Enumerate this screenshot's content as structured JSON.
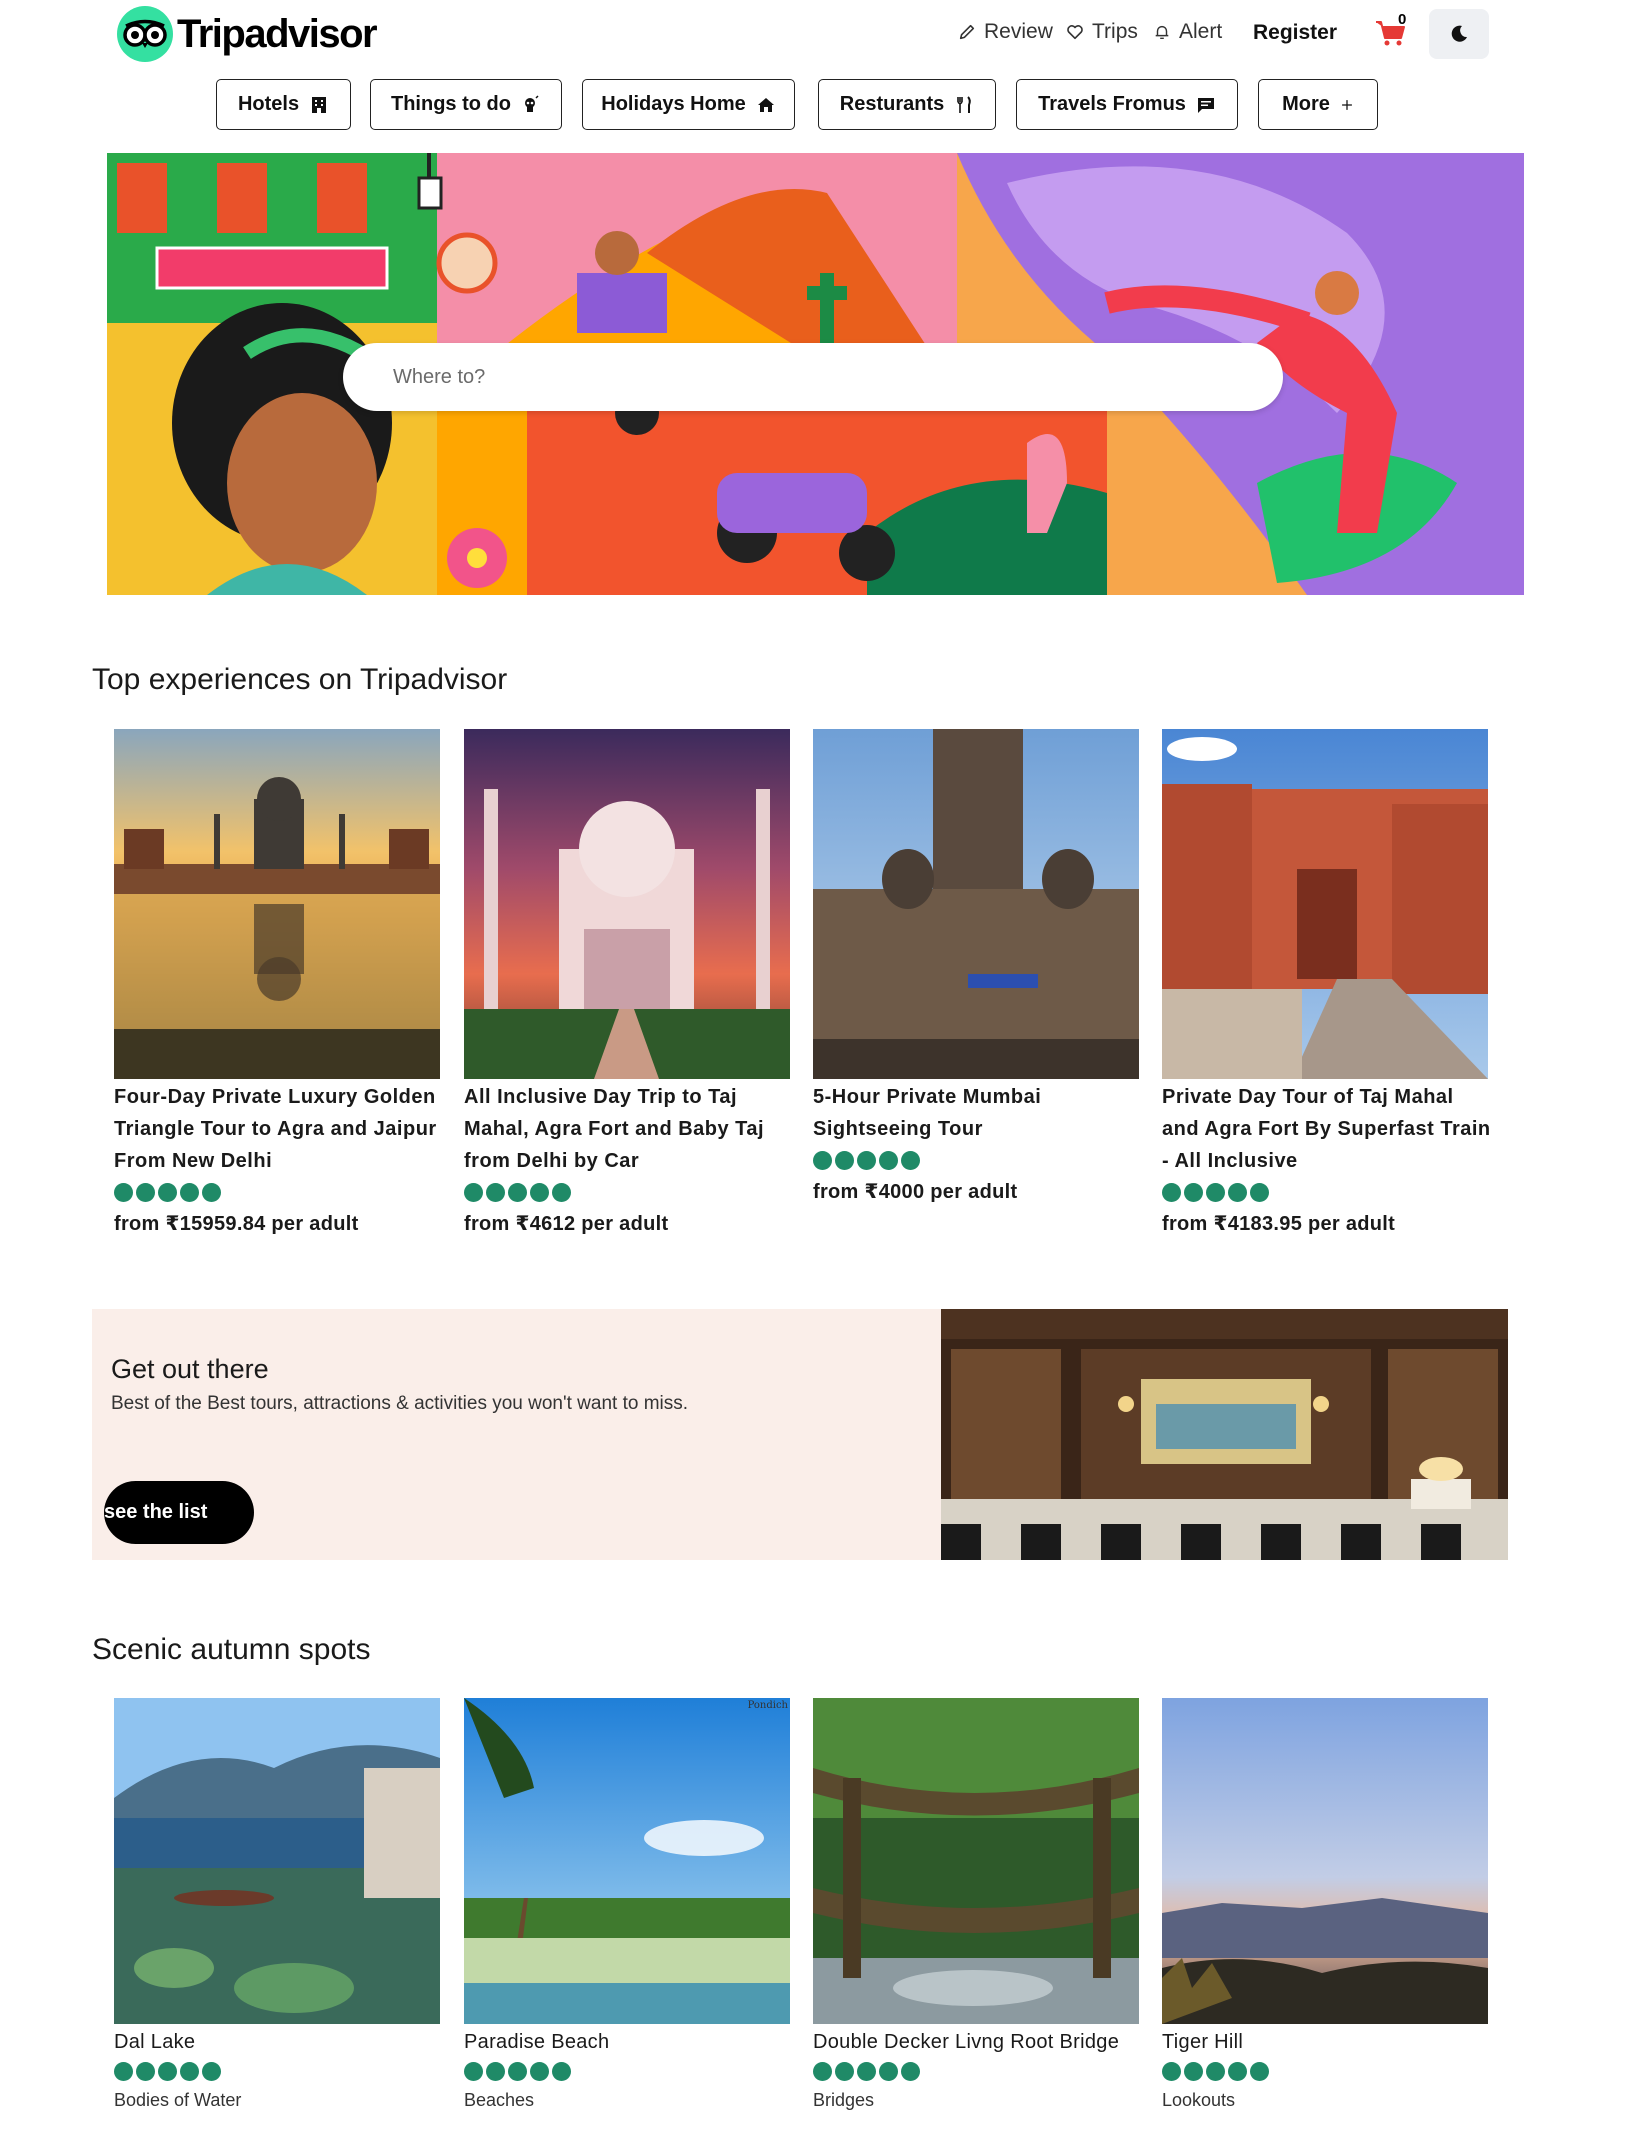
{
  "brand": {
    "name": "Tripadvisor"
  },
  "topnav": {
    "review": "Review",
    "trips": "Trips",
    "alert": "Alert",
    "register": "Register",
    "cart_count": "0"
  },
  "categories": [
    "Hotels",
    "Things to do",
    "Holidays Home",
    "Resturants",
    "Travels Fromus",
    "More"
  ],
  "search": {
    "placeholder": "Where to?"
  },
  "top_experiences": {
    "title": "Top experiences on Tripadvisor",
    "items": [
      {
        "title": "Four-Day Private Luxury Golden Triangle Tour to Agra and Jaipur From New Delhi",
        "rating": 5,
        "price": "from ₹15959.84 per adult"
      },
      {
        "title": "All Inclusive Day Trip to Taj Mahal, Agra Fort and Baby Taj from Delhi by Car",
        "rating": 5,
        "price": "from ₹4612 per adult"
      },
      {
        "title": "5-Hour Private Mumbai Sightseeing Tour",
        "rating": 5,
        "price": "from ₹4000 per adult"
      },
      {
        "title": "Private Day Tour of Taj Mahal and Agra Fort By Superfast Train - All Inclusive",
        "rating": 5,
        "price": "from ₹4183.95 per adult"
      }
    ]
  },
  "promo": {
    "title": "Get out there",
    "subtitle": "Best of the Best tours, attractions & activities you won't want to miss.",
    "button": "see the list"
  },
  "scenic": {
    "title": "Scenic autumn spots",
    "items": [
      {
        "name": "Dal Lake",
        "rating": 5,
        "category": "Bodies of Water"
      },
      {
        "name": "Paradise Beach",
        "rating": 5,
        "category": "Beaches",
        "image_caption": "Pondich"
      },
      {
        "name": "Double Decker Livng Root Bridge",
        "rating": 5,
        "category": "Bridges"
      },
      {
        "name": "Tiger Hill",
        "rating": 5,
        "category": "Lookouts"
      }
    ]
  },
  "colors": {
    "rating_dot": "#1f8a67",
    "brand_green": "#34e0a1",
    "promo_bg": "#faeee9"
  }
}
